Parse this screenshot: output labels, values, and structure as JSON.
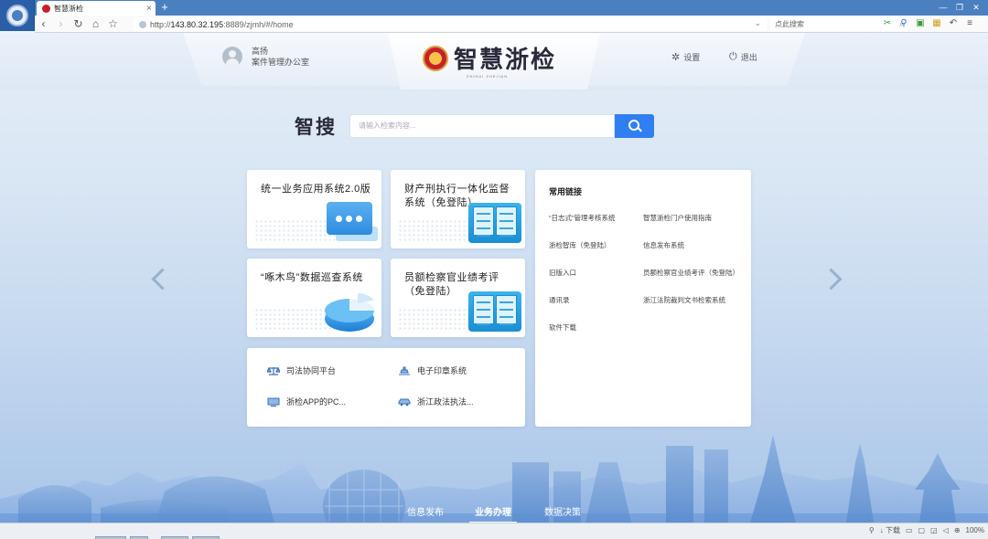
{
  "browser": {
    "tab_title": "智慧浙检",
    "tab_close": "×",
    "new_tab": "+",
    "url_host": "143.80.32.195",
    "url_rest": ":8889/zjmh/#/home",
    "url_prefix": "http://",
    "search_placeholder": "点此搜索",
    "zoom": "100%"
  },
  "header": {
    "user_name": "高扬",
    "user_dept": "案件管理办公室",
    "logo_text": "智慧浙检",
    "logo_sub": "ZHIHUI ZHEJIAN",
    "settings_label": "设置",
    "logout_label": "退出"
  },
  "search": {
    "label": "智搜",
    "placeholder": "请输入检索内容..."
  },
  "systems": [
    {
      "title": "统一业务应用系统2.0版"
    },
    {
      "title": "财产刑执行一体化监督系统（免登陆）"
    },
    {
      "title": "“啄木鸟”数据巡查系统"
    },
    {
      "title": "员额检察官业绩考评（免登陆）"
    }
  ],
  "quick_links": [
    {
      "label": "司法协同平台",
      "icon": "scales-icon"
    },
    {
      "label": "电子印章系统",
      "icon": "stamp-icon"
    },
    {
      "label": "浙检APP的PC...",
      "icon": "monitor-icon"
    },
    {
      "label": "浙江政法执法...",
      "icon": "car-icon"
    }
  ],
  "common_links": {
    "title": "常用链接",
    "items": [
      "“日志式”管理考核系统",
      "智慧浙检门户使用指南",
      "浙检智库（免登陆）",
      "信息发布系统",
      "旧版入口",
      "员额检察官业绩考评（免登陆）",
      "通讯录",
      "浙江法院裁判文书检索系统",
      "软件下载"
    ]
  },
  "bottom_tabs": [
    "信息发布",
    "业务办理",
    "数据决策"
  ],
  "active_tab": "业务办理"
}
